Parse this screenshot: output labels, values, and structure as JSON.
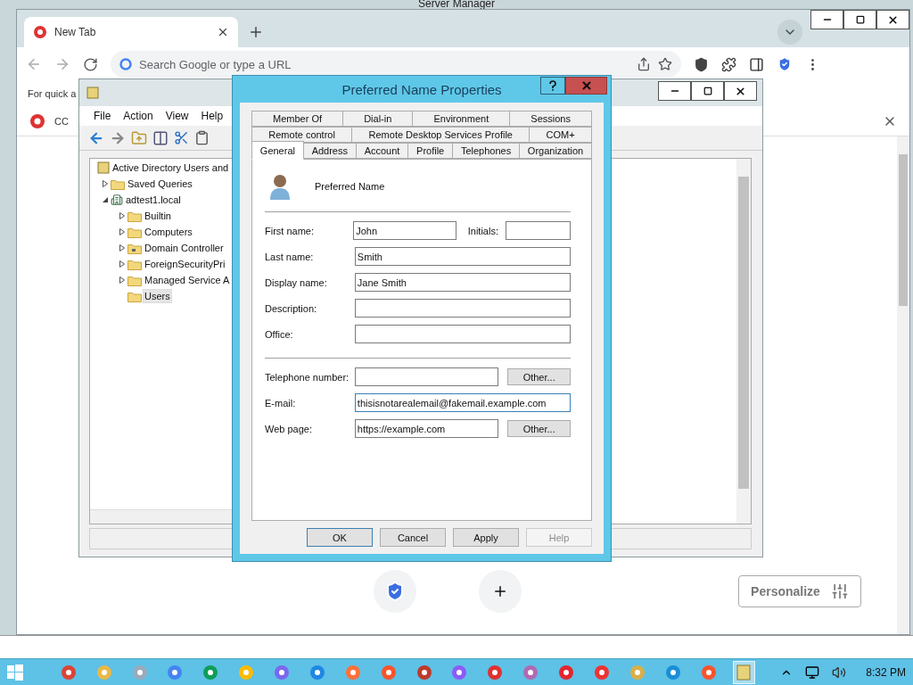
{
  "server_manager": {
    "title": "Server Manager"
  },
  "browser": {
    "tabs": [
      {
        "label": "New Tab",
        "selected": true
      }
    ],
    "address_bar": {
      "placeholder": "Search Google or type a URL"
    },
    "bookmarks_hint": "For quick a",
    "notice": {
      "text": "CC"
    },
    "shortcuts": [
      {
        "kind": "shield"
      },
      {
        "kind": "add"
      }
    ],
    "personalize_button": "Personalize"
  },
  "mmc": {
    "menu": [
      "File",
      "Action",
      "View",
      "Help"
    ],
    "tree": [
      {
        "label": "Active Directory Users and",
        "kind": "snapin",
        "selected": false,
        "children": [
          {
            "label": "Saved Queries",
            "kind": "folder",
            "expanded": false,
            "selected": false
          },
          {
            "label": "adtest1.local",
            "kind": "domain",
            "expanded": true,
            "selected": false,
            "children": [
              {
                "label": "Builtin",
                "kind": "folder",
                "expanded": false,
                "selected": false
              },
              {
                "label": "Computers",
                "kind": "folder",
                "expanded": false,
                "selected": false
              },
              {
                "label": "Domain Controller",
                "kind": "ou",
                "expanded": false,
                "selected": false
              },
              {
                "label": "ForeignSecurityPri",
                "kind": "folder",
                "expanded": false,
                "selected": false
              },
              {
                "label": "Managed Service A",
                "kind": "folder",
                "expanded": false,
                "selected": false
              },
              {
                "label": "Users",
                "kind": "folder",
                "selected": true
              }
            ]
          }
        ]
      }
    ]
  },
  "dialog": {
    "title": "Preferred Name Properties",
    "tab_rows": [
      [
        {
          "label": "Member Of",
          "selected": false
        },
        {
          "label": "Dial-in",
          "selected": false
        },
        {
          "label": "Environment",
          "selected": false
        },
        {
          "label": "Sessions",
          "selected": false
        }
      ],
      [
        {
          "label": "Remote control",
          "selected": false
        },
        {
          "label": "Remote Desktop Services Profile",
          "selected": false
        },
        {
          "label": "COM+",
          "selected": false
        }
      ],
      [
        {
          "label": "General",
          "selected": true
        },
        {
          "label": "Address",
          "selected": false
        },
        {
          "label": "Account",
          "selected": false
        },
        {
          "label": "Profile",
          "selected": false
        },
        {
          "label": "Telephones",
          "selected": false
        },
        {
          "label": "Organization",
          "selected": false
        }
      ]
    ],
    "object_name": "Preferred Name",
    "field_groups": [
      [
        {
          "label": "First name:",
          "value": "John",
          "focused": false,
          "side": {
            "label": "Initials:"
          }
        },
        {
          "label": "Last name:",
          "value": "Smith",
          "focused": false
        },
        {
          "label": "Display name:",
          "value": "Jane Smith",
          "focused": false
        },
        {
          "label": "Description:",
          "focused": false
        },
        {
          "label": "Office:",
          "focused": false
        }
      ],
      [
        {
          "label": "Telephone number:",
          "focused": false,
          "button": "Other..."
        },
        {
          "label": "E-mail:",
          "value": "thisisnotarealemail@fakemail.example.com",
          "focused": true
        },
        {
          "label": "Web page:",
          "value": "https://example.com",
          "focused": false,
          "button": "Other..."
        }
      ]
    ],
    "buttons": [
      {
        "label": "OK",
        "default": true,
        "disabled": false
      },
      {
        "label": "Cancel",
        "default": false,
        "disabled": false
      },
      {
        "label": "Apply",
        "default": false,
        "disabled": false
      },
      {
        "label": "Help",
        "default": false,
        "disabled": true
      }
    ]
  },
  "taskbar": {
    "clock": "8:32 PM"
  }
}
